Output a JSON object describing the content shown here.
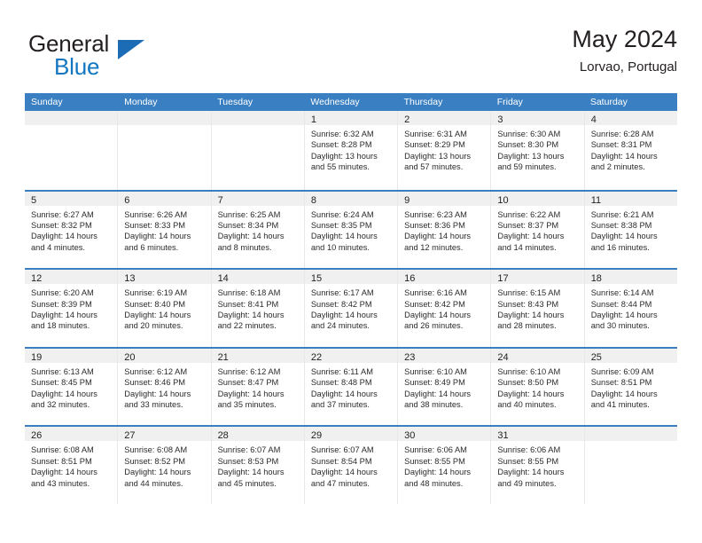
{
  "brand": {
    "name_part1": "General",
    "name_part2": "Blue",
    "triangle_color": "#1b6cb5",
    "blue_text_color": "#1277c0"
  },
  "header": {
    "title": "May 2024",
    "subtitle": "Lorvao, Portugal",
    "header_bg": "#3a7fc1",
    "header_text_color": "#ffffff"
  },
  "weekday_headers": [
    "Sunday",
    "Monday",
    "Tuesday",
    "Wednesday",
    "Thursday",
    "Friday",
    "Saturday"
  ],
  "labels": {
    "sunrise_prefix": "Sunrise:",
    "sunset_prefix": "Sunset:",
    "daylight_prefix": "Daylight:"
  },
  "weeks": [
    [
      {
        "empty": true
      },
      {
        "empty": true
      },
      {
        "empty": true
      },
      {
        "day": "1",
        "sunrise": "Sunrise: 6:32 AM",
        "sunset": "Sunset: 8:28 PM",
        "daylight_line1": "Daylight: 13 hours",
        "daylight_line2": "and 55 minutes."
      },
      {
        "day": "2",
        "sunrise": "Sunrise: 6:31 AM",
        "sunset": "Sunset: 8:29 PM",
        "daylight_line1": "Daylight: 13 hours",
        "daylight_line2": "and 57 minutes."
      },
      {
        "day": "3",
        "sunrise": "Sunrise: 6:30 AM",
        "sunset": "Sunset: 8:30 PM",
        "daylight_line1": "Daylight: 13 hours",
        "daylight_line2": "and 59 minutes."
      },
      {
        "day": "4",
        "sunrise": "Sunrise: 6:28 AM",
        "sunset": "Sunset: 8:31 PM",
        "daylight_line1": "Daylight: 14 hours",
        "daylight_line2": "and 2 minutes."
      }
    ],
    [
      {
        "day": "5",
        "sunrise": "Sunrise: 6:27 AM",
        "sunset": "Sunset: 8:32 PM",
        "daylight_line1": "Daylight: 14 hours",
        "daylight_line2": "and 4 minutes."
      },
      {
        "day": "6",
        "sunrise": "Sunrise: 6:26 AM",
        "sunset": "Sunset: 8:33 PM",
        "daylight_line1": "Daylight: 14 hours",
        "daylight_line2": "and 6 minutes."
      },
      {
        "day": "7",
        "sunrise": "Sunrise: 6:25 AM",
        "sunset": "Sunset: 8:34 PM",
        "daylight_line1": "Daylight: 14 hours",
        "daylight_line2": "and 8 minutes."
      },
      {
        "day": "8",
        "sunrise": "Sunrise: 6:24 AM",
        "sunset": "Sunset: 8:35 PM",
        "daylight_line1": "Daylight: 14 hours",
        "daylight_line2": "and 10 minutes."
      },
      {
        "day": "9",
        "sunrise": "Sunrise: 6:23 AM",
        "sunset": "Sunset: 8:36 PM",
        "daylight_line1": "Daylight: 14 hours",
        "daylight_line2": "and 12 minutes."
      },
      {
        "day": "10",
        "sunrise": "Sunrise: 6:22 AM",
        "sunset": "Sunset: 8:37 PM",
        "daylight_line1": "Daylight: 14 hours",
        "daylight_line2": "and 14 minutes."
      },
      {
        "day": "11",
        "sunrise": "Sunrise: 6:21 AM",
        "sunset": "Sunset: 8:38 PM",
        "daylight_line1": "Daylight: 14 hours",
        "daylight_line2": "and 16 minutes."
      }
    ],
    [
      {
        "day": "12",
        "sunrise": "Sunrise: 6:20 AM",
        "sunset": "Sunset: 8:39 PM",
        "daylight_line1": "Daylight: 14 hours",
        "daylight_line2": "and 18 minutes."
      },
      {
        "day": "13",
        "sunrise": "Sunrise: 6:19 AM",
        "sunset": "Sunset: 8:40 PM",
        "daylight_line1": "Daylight: 14 hours",
        "daylight_line2": "and 20 minutes."
      },
      {
        "day": "14",
        "sunrise": "Sunrise: 6:18 AM",
        "sunset": "Sunset: 8:41 PM",
        "daylight_line1": "Daylight: 14 hours",
        "daylight_line2": "and 22 minutes."
      },
      {
        "day": "15",
        "sunrise": "Sunrise: 6:17 AM",
        "sunset": "Sunset: 8:42 PM",
        "daylight_line1": "Daylight: 14 hours",
        "daylight_line2": "and 24 minutes."
      },
      {
        "day": "16",
        "sunrise": "Sunrise: 6:16 AM",
        "sunset": "Sunset: 8:42 PM",
        "daylight_line1": "Daylight: 14 hours",
        "daylight_line2": "and 26 minutes."
      },
      {
        "day": "17",
        "sunrise": "Sunrise: 6:15 AM",
        "sunset": "Sunset: 8:43 PM",
        "daylight_line1": "Daylight: 14 hours",
        "daylight_line2": "and 28 minutes."
      },
      {
        "day": "18",
        "sunrise": "Sunrise: 6:14 AM",
        "sunset": "Sunset: 8:44 PM",
        "daylight_line1": "Daylight: 14 hours",
        "daylight_line2": "and 30 minutes."
      }
    ],
    [
      {
        "day": "19",
        "sunrise": "Sunrise: 6:13 AM",
        "sunset": "Sunset: 8:45 PM",
        "daylight_line1": "Daylight: 14 hours",
        "daylight_line2": "and 32 minutes."
      },
      {
        "day": "20",
        "sunrise": "Sunrise: 6:12 AM",
        "sunset": "Sunset: 8:46 PM",
        "daylight_line1": "Daylight: 14 hours",
        "daylight_line2": "and 33 minutes."
      },
      {
        "day": "21",
        "sunrise": "Sunrise: 6:12 AM",
        "sunset": "Sunset: 8:47 PM",
        "daylight_line1": "Daylight: 14 hours",
        "daylight_line2": "and 35 minutes."
      },
      {
        "day": "22",
        "sunrise": "Sunrise: 6:11 AM",
        "sunset": "Sunset: 8:48 PM",
        "daylight_line1": "Daylight: 14 hours",
        "daylight_line2": "and 37 minutes."
      },
      {
        "day": "23",
        "sunrise": "Sunrise: 6:10 AM",
        "sunset": "Sunset: 8:49 PM",
        "daylight_line1": "Daylight: 14 hours",
        "daylight_line2": "and 38 minutes."
      },
      {
        "day": "24",
        "sunrise": "Sunrise: 6:10 AM",
        "sunset": "Sunset: 8:50 PM",
        "daylight_line1": "Daylight: 14 hours",
        "daylight_line2": "and 40 minutes."
      },
      {
        "day": "25",
        "sunrise": "Sunrise: 6:09 AM",
        "sunset": "Sunset: 8:51 PM",
        "daylight_line1": "Daylight: 14 hours",
        "daylight_line2": "and 41 minutes."
      }
    ],
    [
      {
        "day": "26",
        "sunrise": "Sunrise: 6:08 AM",
        "sunset": "Sunset: 8:51 PM",
        "daylight_line1": "Daylight: 14 hours",
        "daylight_line2": "and 43 minutes."
      },
      {
        "day": "27",
        "sunrise": "Sunrise: 6:08 AM",
        "sunset": "Sunset: 8:52 PM",
        "daylight_line1": "Daylight: 14 hours",
        "daylight_line2": "and 44 minutes."
      },
      {
        "day": "28",
        "sunrise": "Sunrise: 6:07 AM",
        "sunset": "Sunset: 8:53 PM",
        "daylight_line1": "Daylight: 14 hours",
        "daylight_line2": "and 45 minutes."
      },
      {
        "day": "29",
        "sunrise": "Sunrise: 6:07 AM",
        "sunset": "Sunset: 8:54 PM",
        "daylight_line1": "Daylight: 14 hours",
        "daylight_line2": "and 47 minutes."
      },
      {
        "day": "30",
        "sunrise": "Sunrise: 6:06 AM",
        "sunset": "Sunset: 8:55 PM",
        "daylight_line1": "Daylight: 14 hours",
        "daylight_line2": "and 48 minutes."
      },
      {
        "day": "31",
        "sunrise": "Sunrise: 6:06 AM",
        "sunset": "Sunset: 8:55 PM",
        "daylight_line1": "Daylight: 14 hours",
        "daylight_line2": "and 49 minutes."
      },
      {
        "empty": true
      }
    ]
  ]
}
